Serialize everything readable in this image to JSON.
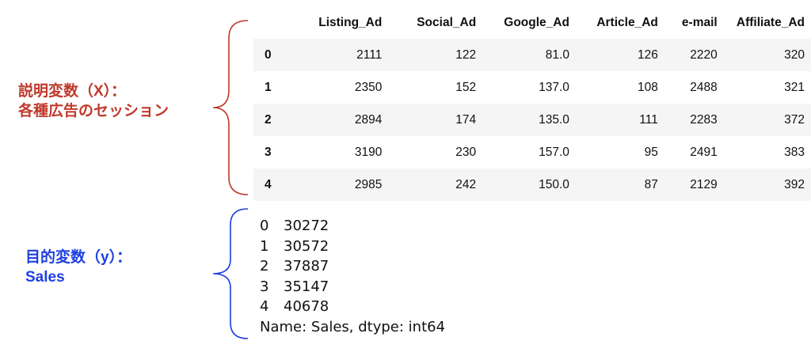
{
  "annotations": {
    "x_line1": "説明変数（X）：",
    "x_line2": "各種広告のセッション",
    "y_line1": "目的変数（y）：",
    "y_line2": "Sales",
    "x_color": "#c0392b",
    "y_color": "#1f3fe0"
  },
  "dataframe": {
    "columns": [
      "Listing_Ad",
      "Social_Ad",
      "Google_Ad",
      "Article_Ad",
      "e-mail",
      "Affiliate_Ad"
    ],
    "rows": [
      {
        "index": "0",
        "values": [
          "2111",
          "122",
          "81.0",
          "126",
          "2220",
          "320"
        ]
      },
      {
        "index": "1",
        "values": [
          "2350",
          "152",
          "137.0",
          "108",
          "2488",
          "321"
        ]
      },
      {
        "index": "2",
        "values": [
          "2894",
          "174",
          "135.0",
          "111",
          "2283",
          "372"
        ]
      },
      {
        "index": "3",
        "values": [
          "3190",
          "230",
          "157.0",
          "95",
          "2491",
          "383"
        ]
      },
      {
        "index": "4",
        "values": [
          "2985",
          "242",
          "150.0",
          "87",
          "2129",
          "392"
        ]
      }
    ]
  },
  "series": {
    "rows": [
      {
        "index": "0",
        "value": "30272"
      },
      {
        "index": "1",
        "value": "30572"
      },
      {
        "index": "2",
        "value": "37887"
      },
      {
        "index": "3",
        "value": "35147"
      },
      {
        "index": "4",
        "value": "40678"
      }
    ],
    "footer": "Name: Sales, dtype: int64"
  }
}
